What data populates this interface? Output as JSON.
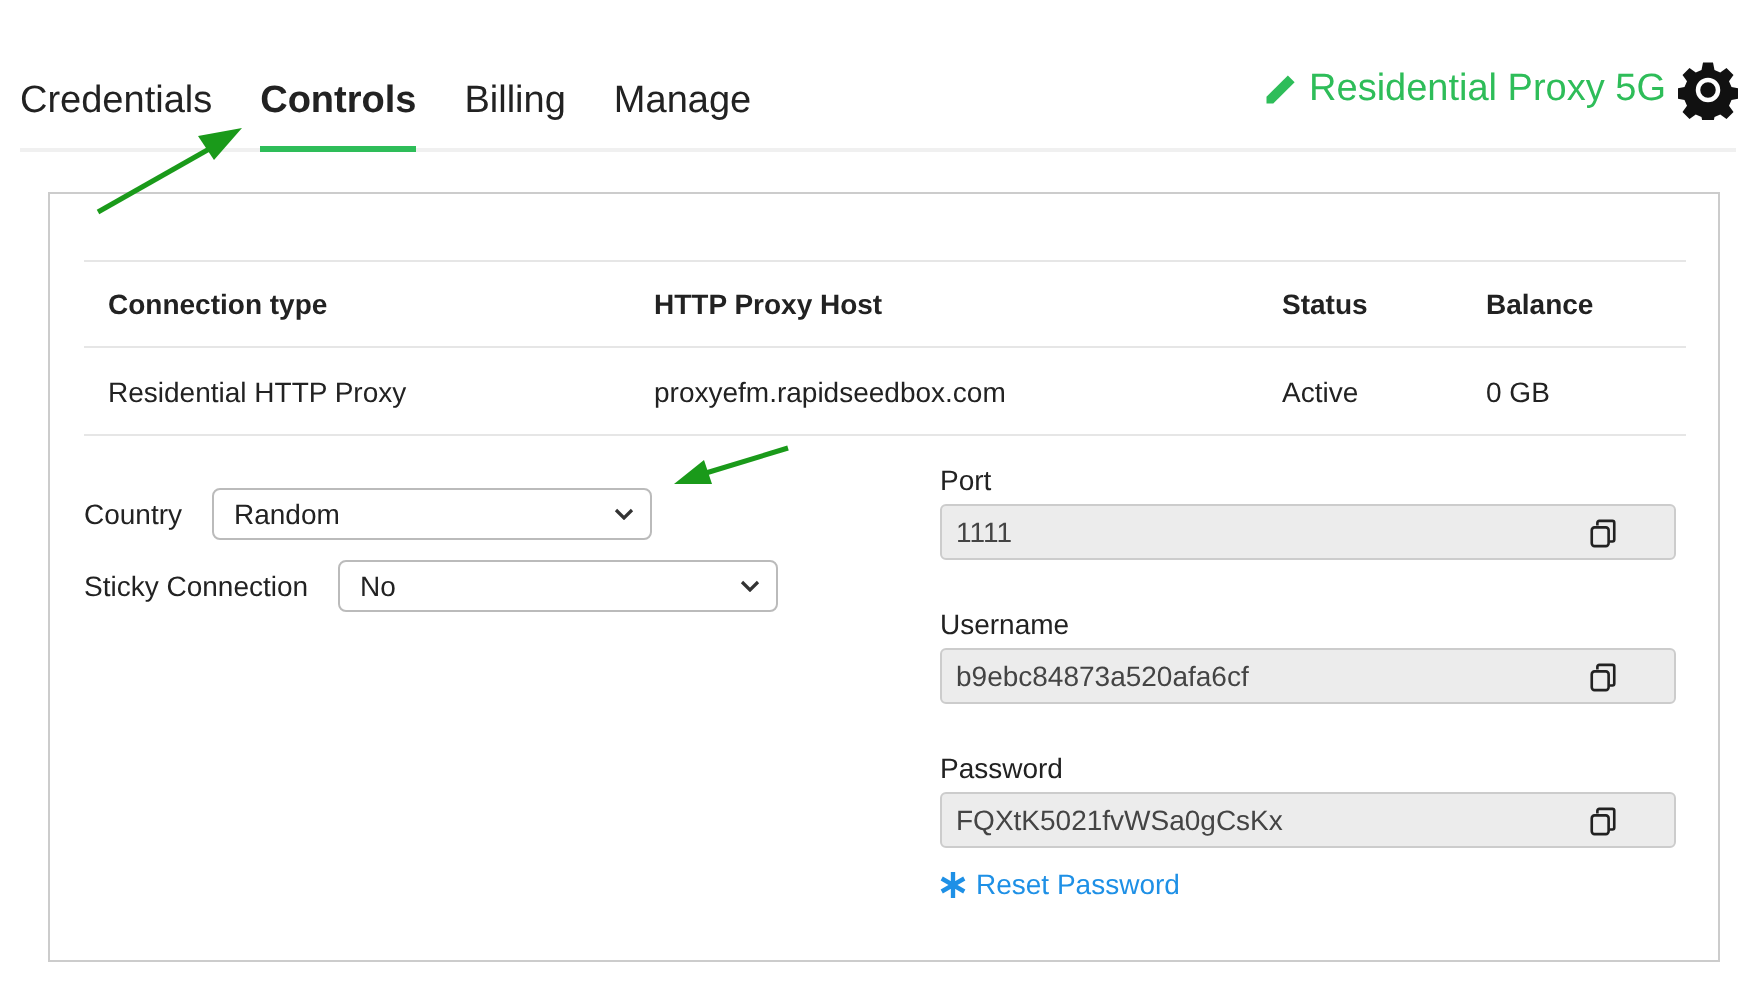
{
  "tabs": [
    {
      "label": "Credentials",
      "selected": false
    },
    {
      "label": "Controls",
      "selected": true
    },
    {
      "label": "Billing",
      "selected": false
    },
    {
      "label": "Manage",
      "selected": false
    }
  ],
  "product": {
    "name": "Residential Proxy 5G"
  },
  "table": {
    "columns": [
      "Connection type",
      "HTTP Proxy Host",
      "Status",
      "Balance"
    ],
    "rows": [
      [
        "Residential HTTP Proxy",
        "proxyefm.rapidseedbox.com",
        "Active",
        "0 GB"
      ]
    ]
  },
  "selects": [
    {
      "label": "Country",
      "value": "Random"
    },
    {
      "label": "Sticky Connection",
      "value": "No"
    }
  ],
  "fields": [
    {
      "label": "Port",
      "value": "1111"
    },
    {
      "label": "Username",
      "value": "b9ebc84873a520afa6cf"
    },
    {
      "label": "Password",
      "value": "FQXtK5021fvWSa0gCsKx"
    }
  ],
  "reset_link": "Reset Password"
}
